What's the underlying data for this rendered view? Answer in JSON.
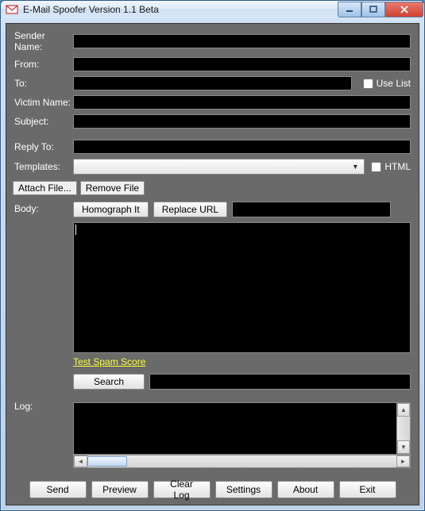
{
  "window": {
    "title": "E-Mail Spoofer Version 1.1 Beta"
  },
  "labels": {
    "sender_name": "Sender Name:",
    "from": "From:",
    "to": "To:",
    "victim_name": "Victim Name:",
    "subject": "Subject:",
    "reply_to": "Reply To:",
    "templates": "Templates:",
    "body": "Body:",
    "log": "Log:"
  },
  "checkboxes": {
    "use_list": "Use List",
    "html": "HTML"
  },
  "buttons": {
    "attach_file": "Attach File...",
    "remove_file": "Remove File",
    "homograph": "Homograph It",
    "replace_url": "Replace URL",
    "search": "Search",
    "send": "Send",
    "preview": "Preview",
    "clear_log": "Clear Log",
    "settings": "Settings",
    "about": "About",
    "exit": "Exit"
  },
  "links": {
    "test_spam": "Test Spam Score"
  },
  "fields": {
    "sender_name": "",
    "from": "",
    "to": "",
    "victim_name": "",
    "subject": "",
    "reply_to": "",
    "templates_selected": "",
    "replace_url_value": "",
    "body": "",
    "search": "",
    "log": ""
  }
}
